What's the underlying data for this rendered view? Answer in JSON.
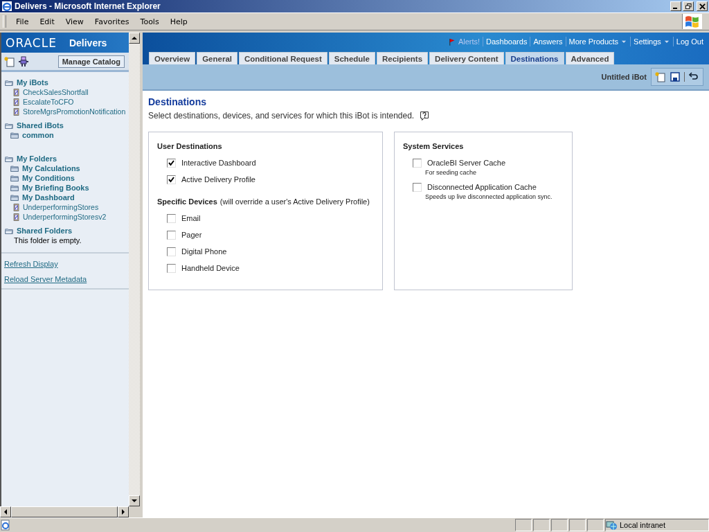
{
  "window": {
    "title": "Delivers - Microsoft Internet Explorer"
  },
  "menu_bar": [
    "File",
    "Edit",
    "View",
    "Favorites",
    "Tools",
    "Help"
  ],
  "sidebar": {
    "brand": "ORACLE",
    "product": "Delivers",
    "manage_button": "Manage Catalog",
    "tree": [
      {
        "label": "My iBots",
        "kind": "section",
        "children": [
          {
            "label": "CheckSalesShortfall",
            "kind": "ibot"
          },
          {
            "label": "EscalateToCFO",
            "kind": "ibot"
          },
          {
            "label": "StoreMgrsPromotionNotification",
            "kind": "ibot"
          }
        ]
      },
      {
        "label": "Shared iBots",
        "kind": "section",
        "children": [
          {
            "label": "common",
            "kind": "folder"
          }
        ]
      },
      {
        "label": "My Folders",
        "kind": "section",
        "children": [
          {
            "label": "My Calculations",
            "kind": "folder"
          },
          {
            "label": "My Conditions",
            "kind": "folder"
          },
          {
            "label": "My Briefing Books",
            "kind": "folder"
          },
          {
            "label": "My Dashboard",
            "kind": "folder"
          },
          {
            "label": "UnderperformingStores",
            "kind": "ibot"
          },
          {
            "label": "UnderperformingStoresv2",
            "kind": "ibot"
          }
        ]
      },
      {
        "label": "Shared Folders",
        "kind": "section",
        "children": [
          {
            "label": "This folder is empty.",
            "kind": "note"
          }
        ]
      }
    ],
    "links": [
      "Refresh Display",
      "Reload Server Metadata"
    ]
  },
  "header_links": [
    {
      "label": "Alerts!",
      "kind": "alert"
    },
    {
      "label": "Dashboards",
      "kind": "link"
    },
    {
      "label": "Answers",
      "kind": "link"
    },
    {
      "label": "More Products",
      "kind": "menu"
    },
    {
      "label": "Settings",
      "kind": "menu"
    },
    {
      "label": "Log Out",
      "kind": "link"
    }
  ],
  "tabs": [
    {
      "label": "Overview",
      "selected": false
    },
    {
      "label": "General",
      "selected": false
    },
    {
      "label": "Conditional Request",
      "selected": false
    },
    {
      "label": "Schedule",
      "selected": false
    },
    {
      "label": "Recipients",
      "selected": false
    },
    {
      "label": "Delivery Content",
      "selected": false
    },
    {
      "label": "Destinations",
      "selected": true
    },
    {
      "label": "Advanced",
      "selected": false
    }
  ],
  "ibot_name": "Untitled iBot",
  "page": {
    "title": "Destinations",
    "description": "Select destinations, devices, and services for which this iBot is intended."
  },
  "panels": [
    {
      "sections": [
        {
          "heading": "User Destinations",
          "options": [
            {
              "label": "Interactive Dashboard",
              "checked": true
            },
            {
              "label": "Active Delivery Profile",
              "checked": true
            }
          ]
        },
        {
          "heading": "Specific Devices",
          "note": "(will override a user's Active Delivery Profile)",
          "options": [
            {
              "label": "Email",
              "checked": false
            },
            {
              "label": "Pager",
              "checked": false
            },
            {
              "label": "Digital Phone",
              "checked": false
            },
            {
              "label": "Handheld Device",
              "checked": false
            }
          ]
        }
      ]
    },
    {
      "sections": [
        {
          "heading": "System Services",
          "options": [
            {
              "label": "OracleBI Server Cache",
              "checked": false,
              "hint": "For seeding cache"
            },
            {
              "label": "Disconnected Application Cache",
              "checked": false,
              "hint": "Speeds up live disconnected application sync."
            }
          ]
        }
      ]
    }
  ],
  "status_bar": {
    "zone": "Local intranet"
  }
}
